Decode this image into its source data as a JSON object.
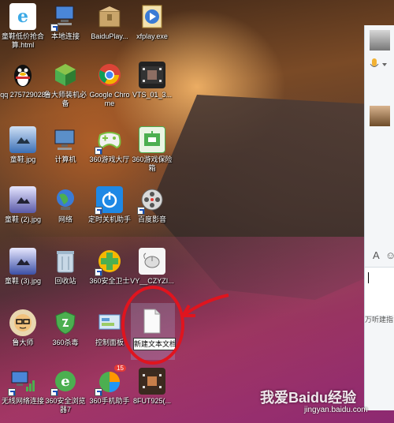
{
  "desktop": {
    "icons": [
      {
        "id": "ie-shortcut",
        "label": "童鞋低价抢合算.html",
        "icon": "ie-document-icon",
        "color": "#ffffff"
      },
      {
        "id": "local-connection",
        "label": "本地连接",
        "icon": "network-connection-icon",
        "color": "#4a86d8"
      },
      {
        "id": "baiduplayer",
        "label": "BaiduPlay...",
        "icon": "baidu-player-icon",
        "color": "#c9a56a"
      },
      {
        "id": "xfplay",
        "label": "xfplay.exe",
        "icon": "xfplay-icon",
        "color": "#3a7bd5"
      },
      {
        "id": "qq",
        "label": "qq 275729028",
        "icon": "qq-penguin-icon",
        "color": "#222222"
      },
      {
        "id": "ludashi-install",
        "label": "鲁大师装机必备",
        "icon": "ludashi-install-icon",
        "color": "#4caf50"
      },
      {
        "id": "chrome",
        "label": "Google Chrome",
        "icon": "chrome-icon",
        "color": "#db4437"
      },
      {
        "id": "vts-file",
        "label": "VTS_01_3...",
        "icon": "video-file-icon",
        "color": "#333333"
      },
      {
        "id": "shoes-jpg",
        "label": "童鞋.jpg",
        "icon": "image-file-icon",
        "color": "#3b6fb5"
      },
      {
        "id": "computer",
        "label": "计算机",
        "icon": "computer-icon",
        "color": "#5b8fc9"
      },
      {
        "id": "360-game-hall",
        "label": "360游戏大厅",
        "icon": "game-controller-icon",
        "color": "#7cc242"
      },
      {
        "id": "360-game-safe",
        "label": "360游戏保险箱",
        "icon": "game-safe-icon",
        "color": "#4caf50"
      },
      {
        "id": "shoes-2-jpg",
        "label": "童鞋 (2).jpg",
        "icon": "image-file-icon",
        "color": "#3b6fb5"
      },
      {
        "id": "network",
        "label": "网络",
        "icon": "globe-network-icon",
        "color": "#3a7bd5"
      },
      {
        "id": "timed-shutdown",
        "label": "定时关机助手",
        "icon": "power-icon",
        "color": "#1e88e5"
      },
      {
        "id": "baidu-video",
        "label": "百度影音",
        "icon": "film-reel-icon",
        "color": "#888888"
      },
      {
        "id": "shoes-3-jpg",
        "label": "童鞋 (3).jpg",
        "icon": "image-file-icon",
        "color": "#3b6fb5"
      },
      {
        "id": "recycle-bin",
        "label": "回收站",
        "icon": "recycle-bin-icon",
        "color": "#9fb8cc"
      },
      {
        "id": "360-safe",
        "label": "360安全卫士",
        "icon": "360-plus-icon",
        "color": "#8bc34a"
      },
      {
        "id": "vy-file",
        "label": "VY__CZYZI...",
        "icon": "mouse-icon",
        "color": "#dddddd"
      },
      {
        "id": "ludashi",
        "label": "鲁大师",
        "icon": "ludashi-icon",
        "color": "#3a7bd5"
      },
      {
        "id": "360-antivirus",
        "label": "360杀毒",
        "icon": "shield-icon",
        "color": "#4caf50"
      },
      {
        "id": "control-panel",
        "label": "控制面板",
        "icon": "control-panel-icon",
        "color": "#5b9bd5"
      },
      {
        "id": "new-text-doc",
        "label": "新建文本文档.",
        "icon": "text-document-icon",
        "color": "#ffffff"
      },
      {
        "id": "wireless",
        "label": "无线网络连接",
        "icon": "wireless-network-icon",
        "color": "#4a86d8"
      },
      {
        "id": "360-browser",
        "label": "360安全浏览器7",
        "icon": "360-browser-icon",
        "color": "#4caf50"
      },
      {
        "id": "360-mobile",
        "label": "360手机助手",
        "icon": "360-mobile-icon",
        "color": "#ff9800"
      },
      {
        "id": "8fut-file",
        "label": "8FUT925(...",
        "icon": "video-file-icon",
        "color": "#444444"
      }
    ],
    "rename_text": "新建文本文档.",
    "badge_15": "15",
    "annotation_color": "#e0141e"
  },
  "chat_panel": {
    "input_hint": "万听建指"
  },
  "watermark": {
    "text": "我爱Baidu经验",
    "url": "jingyan.baidu.com"
  }
}
